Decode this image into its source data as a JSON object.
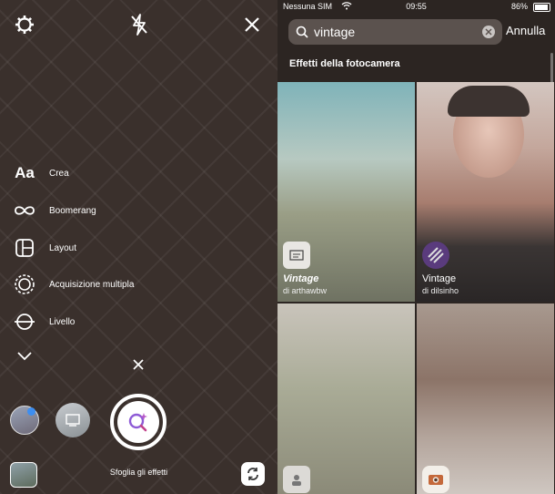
{
  "camera": {
    "menu": [
      {
        "icon": "text-aa-icon",
        "label": "Crea"
      },
      {
        "icon": "infinity-icon",
        "label": "Boomerang"
      },
      {
        "icon": "layout-grid-icon",
        "label": "Layout"
      },
      {
        "icon": "multi-capture-icon",
        "label": "Acquisizione multipla"
      },
      {
        "icon": "level-icon",
        "label": "Livello"
      }
    ],
    "browse_effects_label": "Sfoglia gli effetti",
    "aa_glyph": "Aa",
    "colors": {
      "ring": "#ffffff",
      "accent": "#8e5bd6"
    }
  },
  "status": {
    "carrier": "Nessuna SIM",
    "time": "09:55",
    "battery": "86%"
  },
  "search": {
    "value": "vintage",
    "cancel_label": "Annulla"
  },
  "results": {
    "section_title": "Effetti della fotocamera",
    "effects": [
      {
        "name": "Vintage",
        "author": "di arthawbw",
        "italic": true
      },
      {
        "name": "Vintage",
        "author": "di dilsinho",
        "italic": false
      },
      {
        "name": "",
        "author": "",
        "italic": false
      },
      {
        "name": "",
        "author": "",
        "italic": false
      }
    ]
  }
}
